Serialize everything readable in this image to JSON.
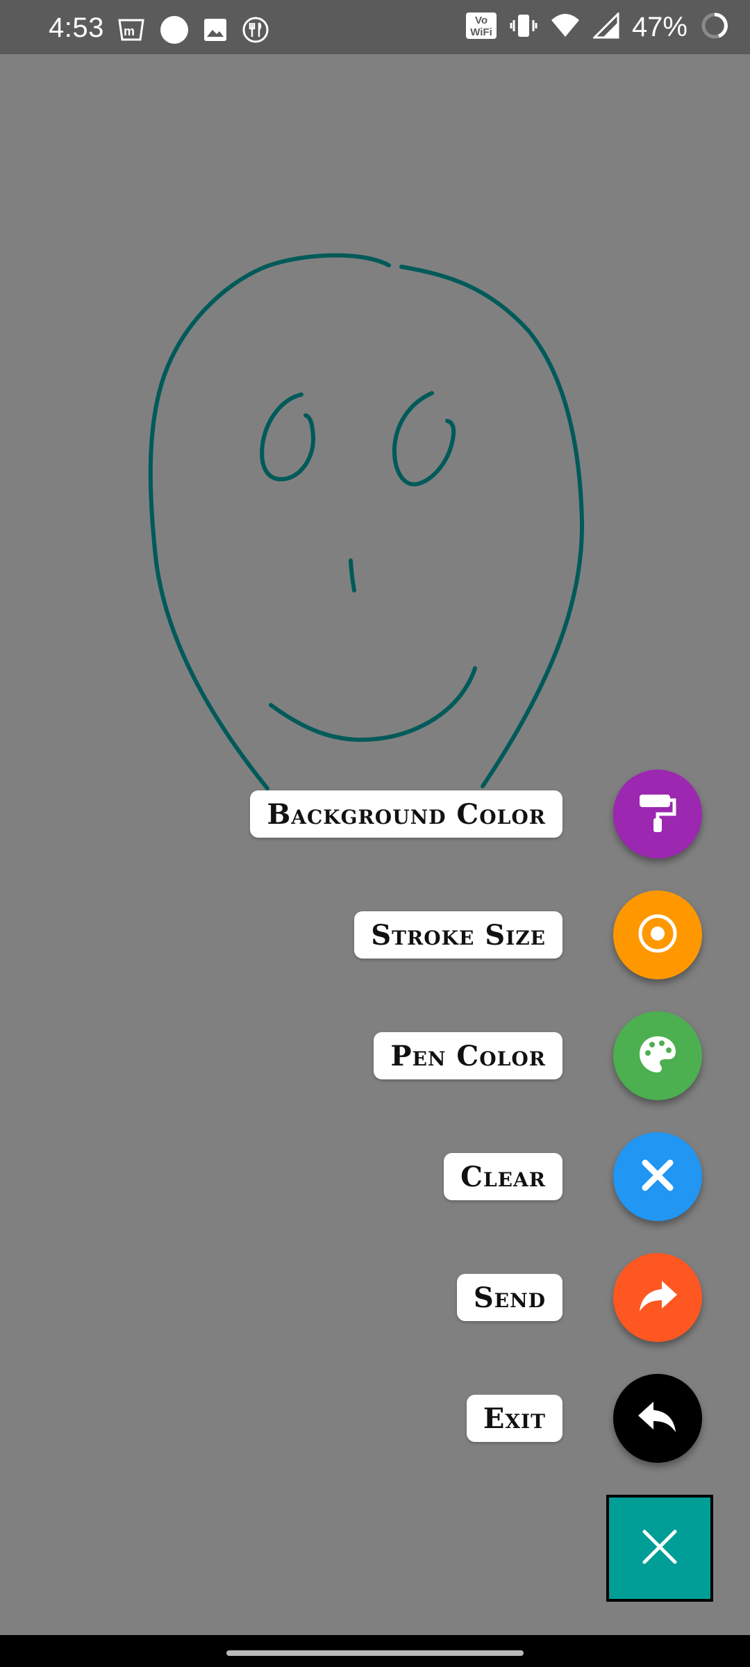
{
  "status_bar": {
    "time": "4:53",
    "battery": "47%",
    "network_badge_line1": "Vo",
    "network_badge_line2": "WiFi",
    "icons": [
      "myntra-icon",
      "circle-notification-icon",
      "image-icon",
      "food-icon",
      "vowifi-icon",
      "vibrate-icon",
      "wifi-icon",
      "cell-signal-icon",
      "battery-ring-icon"
    ]
  },
  "canvas": {
    "background_color": "#808080",
    "pen_color": "#005a5a",
    "drawing": "smiley-face"
  },
  "menu": {
    "items": [
      {
        "label": "Background Color",
        "icon": "paint-roller-icon",
        "color": "#9c27b0"
      },
      {
        "label": "Stroke Size",
        "icon": "target-icon",
        "color": "#ff9800"
      },
      {
        "label": "Pen Color",
        "icon": "palette-icon",
        "color": "#4caf50"
      },
      {
        "label": "Clear",
        "icon": "close-icon",
        "color": "#2196f3"
      },
      {
        "label": "Send",
        "icon": "share-forward-icon",
        "color": "#ff5722"
      },
      {
        "label": "Exit",
        "icon": "reply-back-icon",
        "color": "#000000"
      }
    ],
    "toggle": {
      "icon": "close-icon",
      "color": "#009e96"
    }
  }
}
